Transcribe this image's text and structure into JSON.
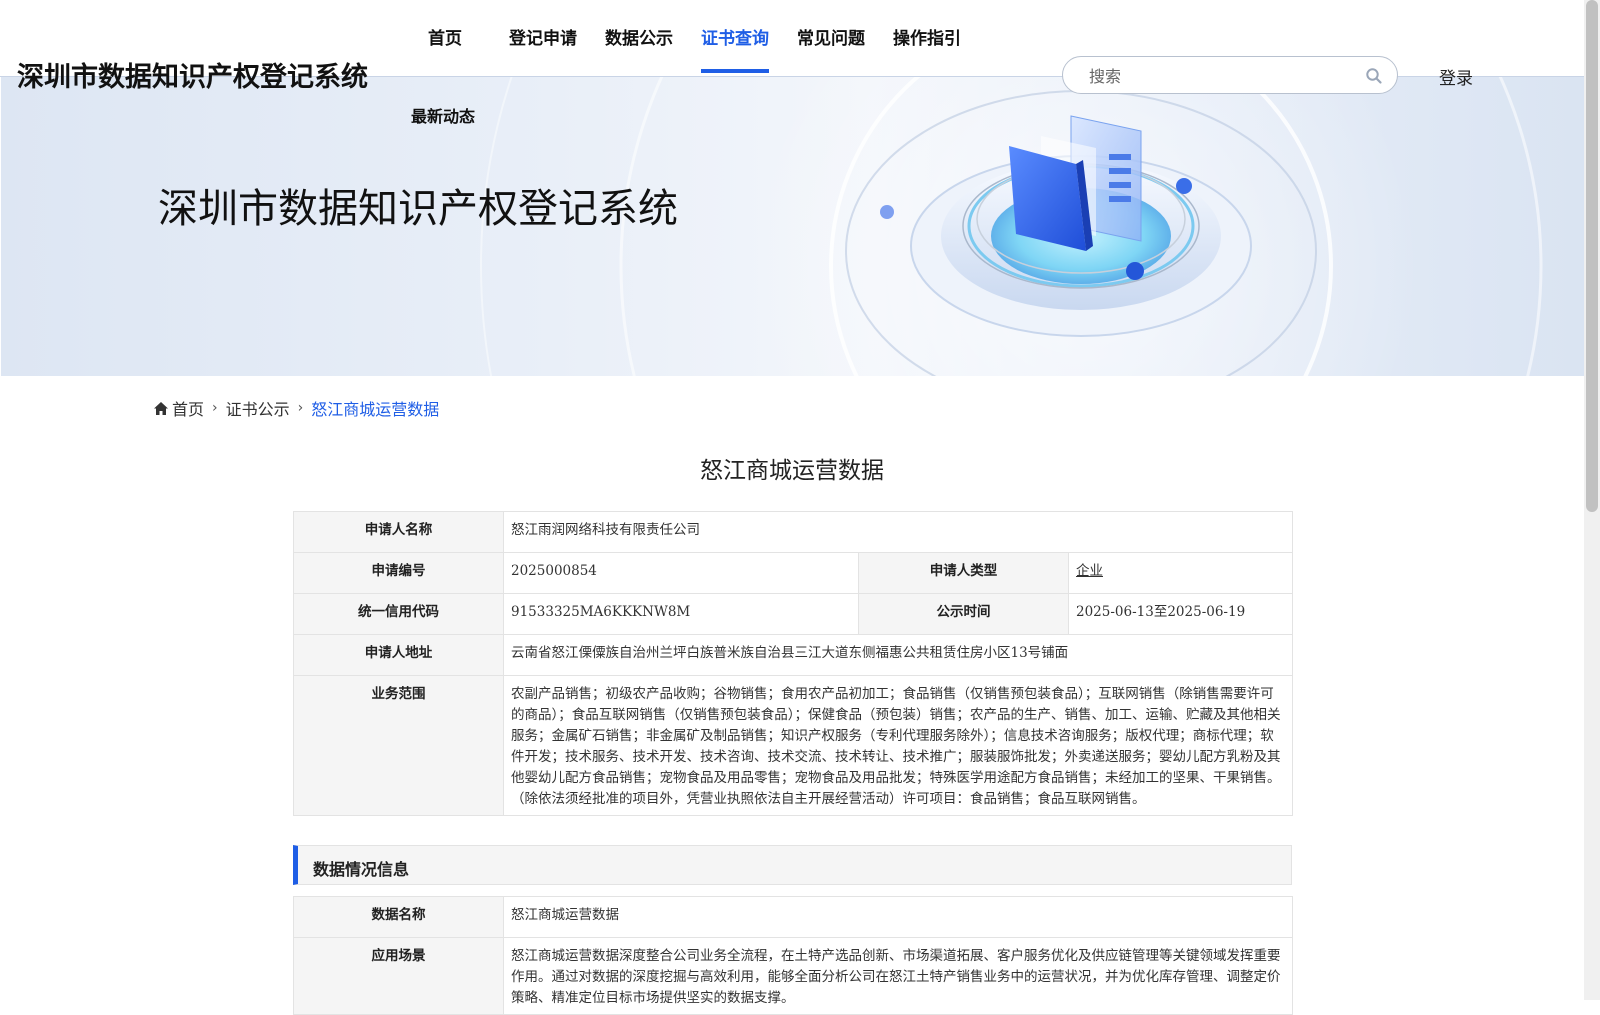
{
  "header": {
    "site_title": "深圳市数据知识产权登记系统",
    "nav": [
      "首页",
      "登记申请",
      "数据公示",
      "证书查询",
      "常见问题",
      "操作指引"
    ],
    "nav_latest": "最新动态",
    "active_nav": "证书查询",
    "search_placeholder": "搜索",
    "login": "登录"
  },
  "banner": {
    "title": "深圳市数据知识产权登记系统"
  },
  "breadcrumb": {
    "home": "首页",
    "level1": "证书公示",
    "current": "怒江商城运营数据"
  },
  "page_title": "怒江商城运营数据",
  "applicant": {
    "name_label": "申请人名称",
    "name": "怒江雨润网络科技有限责任公司",
    "number_label": "申请编号",
    "number": "2025000854",
    "type_label": "申请人类型",
    "type": "企业",
    "credit_label": "统一信用代码",
    "credit": "91533325MA6KKKNW8M",
    "pub_label": "公示时间",
    "pub": "2025-06-13至2025-06-19",
    "address_label": "申请人地址",
    "address": "云南省怒江傈僳族自治州兰坪白族普米族自治县三江大道东侧福惠公共租赁住房小区13号铺面",
    "scope_label": "业务范围",
    "scope": "农副产品销售；初级农产品收购；谷物销售；食用农产品初加工；食品销售（仅销售预包装食品）；互联网销售（除销售需要许可的商品）；食品互联网销售（仅销售预包装食品）；保健食品（预包装）销售；农产品的生产、销售、加工、运输、贮藏及其他相关服务；金属矿石销售；非金属矿及制品销售；知识产权服务（专利代理服务除外）；信息技术咨询服务；版权代理；商标代理；软件开发；技术服务、技术开发、技术咨询、技术交流、技术转让、技术推广；服装服饰批发；外卖递送服务；婴幼儿配方乳粉及其他婴幼儿配方食品销售；宠物食品及用品零售；宠物食品及用品批发；特殊医学用途配方食品销售；未经加工的坚果、干果销售。（除依法须经批准的项目外，凭营业执照依法自主开展经营活动）许可项目：食品销售；食品互联网销售。"
  },
  "data_section": {
    "heading": "数据情况信息",
    "name_label": "数据名称",
    "name": "怒江商城运营数据",
    "scene_label": "应用场景",
    "scene": "怒江商城运营数据深度整合公司业务全流程，在土特产选品创新、市场渠道拓展、客户服务优化及供应链管理等关键领域发挥重要作用。通过对数据的深度挖掘与高效利用，能够全面分析公司在怒江土特产销售业务中的运营状况，并为优化库存管理、调整定价策略、精准定位目标市场提供坚实的数据支撑。"
  },
  "colors": {
    "accent": "#1f5ee6"
  }
}
